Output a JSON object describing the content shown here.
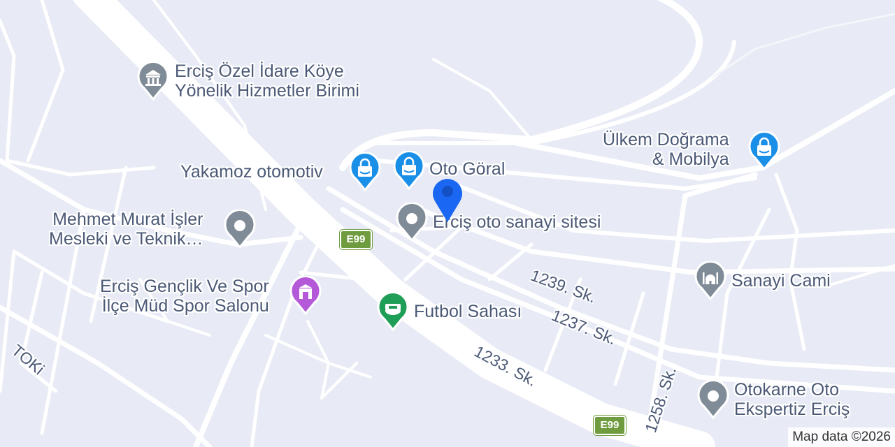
{
  "map": {
    "colors": {
      "land": "#e8ebf5",
      "road": "#ffffff",
      "shopping": "#1a8fe8",
      "generic": "#7f8b97",
      "recreation": "#b45ad9",
      "sports": "#1f9e57",
      "location": "#1967f2",
      "label": "#4b5976"
    },
    "pois": [
      {
        "name": "Erciş Özel İdare Köye",
        "name2": "Yönelik Hizmetler Birimi",
        "icon": "government-building-icon"
      },
      {
        "name": "Yakamoz otomotiv",
        "icon": "shopping-bag-icon"
      },
      {
        "name": "Oto Göral",
        "icon": "shopping-bag-icon"
      },
      {
        "name": "Ülkem Doğrama",
        "name2": "& Mobilya",
        "icon": "shopping-bag-icon"
      },
      {
        "name": "Erciş oto sanayi sitesi",
        "icon": "place-dot-icon"
      },
      {
        "name": "Mehmet Murat İşler",
        "name2": "Mesleki ve Teknik…",
        "icon": "place-dot-icon"
      },
      {
        "name": "Erciş Gençlik Ve Spor",
        "name2": "İlçe Müd Spor Salonu",
        "icon": "gym-icon"
      },
      {
        "name": "Futbol Sahası",
        "icon": "stadium-icon"
      },
      {
        "name": "Sanayi Cami",
        "icon": "mosque-icon"
      },
      {
        "name": "Otokarne Oto",
        "name2": "Ekspertiz Erciş",
        "icon": "place-dot-icon"
      }
    ],
    "streets": [
      "1239. Sk.",
      "1237. Sk.",
      "1233. Sk.",
      "1258. Sk.",
      "TOKi"
    ],
    "route_shields": [
      "E99",
      "E99"
    ],
    "attribution": "Map data ©2026"
  }
}
